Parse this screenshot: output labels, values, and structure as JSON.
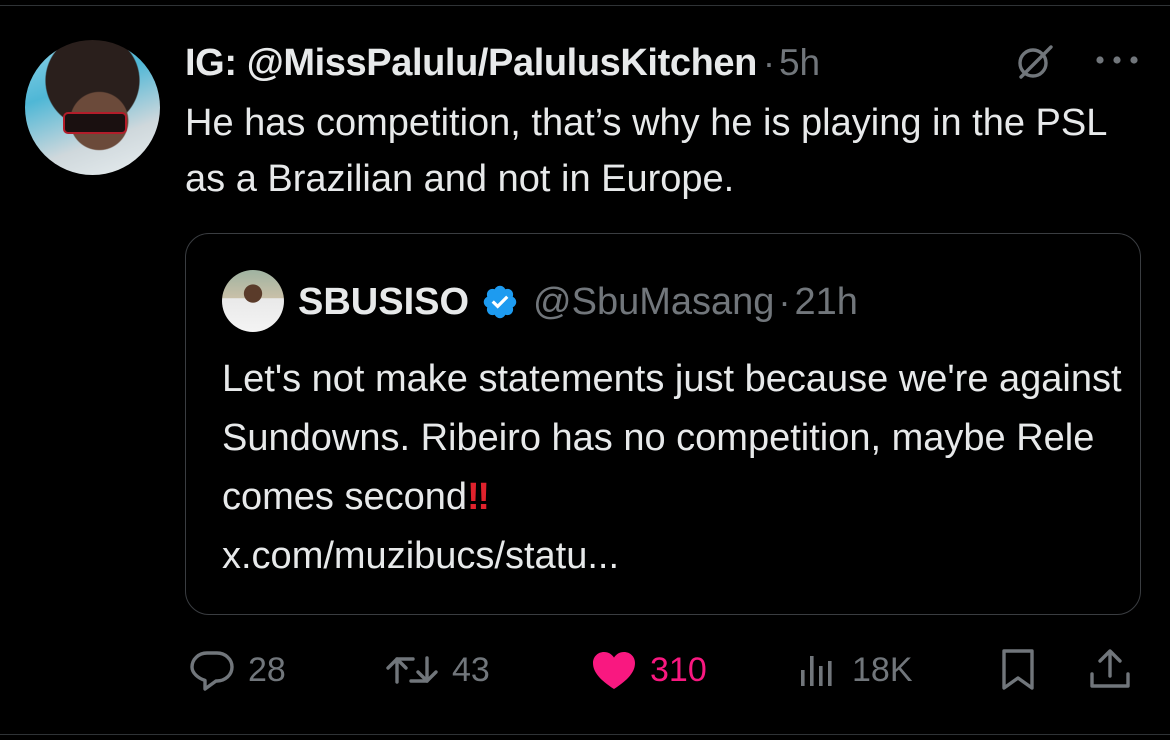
{
  "tweet": {
    "author": "IG: @MissPalulu/PalulusKitchen",
    "separator": "·",
    "time": "5h",
    "text": "He has competition, that’s why he is playing in the PSL as a Brazilian and not in Europe.",
    "icons": {
      "grok": "grok-slash-icon",
      "more": "more-dots-icon",
      "avatar": "profile-photo"
    }
  },
  "quote": {
    "name": "SBUSISO",
    "verified_icon": "verified-badge-icon",
    "verified_color": "#1d9bf0",
    "handle": "@SbuMasang",
    "separator": "·",
    "time": "21h",
    "text": "Let's not make statements just because we're against Sundowns. Ribeiro has no competition, maybe Rele comes second",
    "emphasis": "‼",
    "emphasis_color": "#e0222c",
    "link": "x.com/muzibucs/statu..."
  },
  "actions": {
    "reply": {
      "icon": "reply-icon",
      "count": "28"
    },
    "retweet": {
      "icon": "retweet-icon",
      "count": "43"
    },
    "like": {
      "icon": "heart-icon",
      "count": "310",
      "active": true,
      "color": "#f91880"
    },
    "views": {
      "icon": "views-icon",
      "count": "18K"
    },
    "bookmark": {
      "icon": "bookmark-icon"
    },
    "share": {
      "icon": "share-icon"
    }
  },
  "colors": {
    "background": "#000000",
    "text": "#e7e9ea",
    "secondary": "#71767b",
    "border": "#2f3336"
  }
}
